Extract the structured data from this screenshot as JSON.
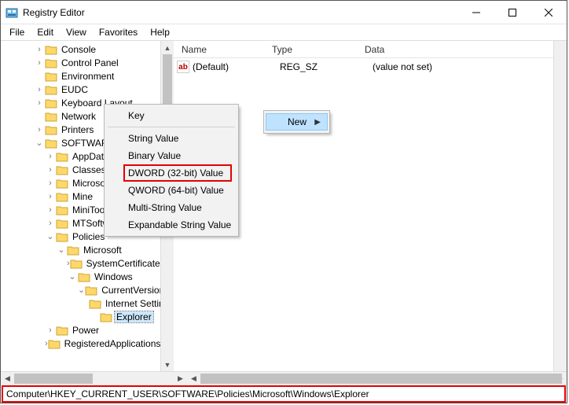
{
  "window": {
    "title": "Registry Editor"
  },
  "menu": {
    "file": "File",
    "edit": "Edit",
    "view": "View",
    "favorites": "Favorites",
    "help": "Help"
  },
  "tree": [
    {
      "d": 3,
      "tw": ">",
      "t": "Console"
    },
    {
      "d": 3,
      "tw": ">",
      "t": "Control Panel"
    },
    {
      "d": 3,
      "tw": "",
      "t": "Environment"
    },
    {
      "d": 3,
      "tw": ">",
      "t": "EUDC"
    },
    {
      "d": 3,
      "tw": ">",
      "t": "Keyboard Layout"
    },
    {
      "d": 3,
      "tw": "",
      "t": "Network"
    },
    {
      "d": 3,
      "tw": ">",
      "t": "Printers"
    },
    {
      "d": 3,
      "tw": "v",
      "t": "SOFTWARE"
    },
    {
      "d": 4,
      "tw": ">",
      "t": "AppDataLow"
    },
    {
      "d": 4,
      "tw": ">",
      "t": "Classes"
    },
    {
      "d": 4,
      "tw": ">",
      "t": "Microsoft"
    },
    {
      "d": 4,
      "tw": ">",
      "t": "Mine"
    },
    {
      "d": 4,
      "tw": ">",
      "t": "MiniTool"
    },
    {
      "d": 4,
      "tw": ">",
      "t": "MTSoftware"
    },
    {
      "d": 4,
      "tw": "v",
      "t": "Policies"
    },
    {
      "d": 5,
      "tw": "v",
      "t": "Microsoft"
    },
    {
      "d": 6,
      "tw": ">",
      "t": "SystemCertificates"
    },
    {
      "d": 6,
      "tw": "v",
      "t": "Windows"
    },
    {
      "d": 7,
      "tw": "v",
      "t": "CurrentVersion"
    },
    {
      "d": 8,
      "tw": "",
      "t": "Internet Settings"
    },
    {
      "d": 8,
      "tw": "",
      "t": "Explorer",
      "sel": true
    },
    {
      "d": 4,
      "tw": ">",
      "t": "Power"
    },
    {
      "d": 4,
      "tw": ">",
      "t": "RegisteredApplications"
    }
  ],
  "columns": {
    "name": "Name",
    "type": "Type",
    "data": "Data"
  },
  "values": [
    {
      "icon": "ab",
      "name": "(Default)",
      "type": "REG_SZ",
      "data": "(value not set)"
    }
  ],
  "ctx_main": {
    "new": "New"
  },
  "ctx_sub": {
    "key": "Key",
    "string": "String Value",
    "binary": "Binary Value",
    "dword": "DWORD (32-bit) Value",
    "qword": "QWORD (64-bit) Value",
    "multi": "Multi-String Value",
    "expand": "Expandable String Value"
  },
  "address": "Computer\\HKEY_CURRENT_USER\\SOFTWARE\\Policies\\Microsoft\\Windows\\Explorer"
}
